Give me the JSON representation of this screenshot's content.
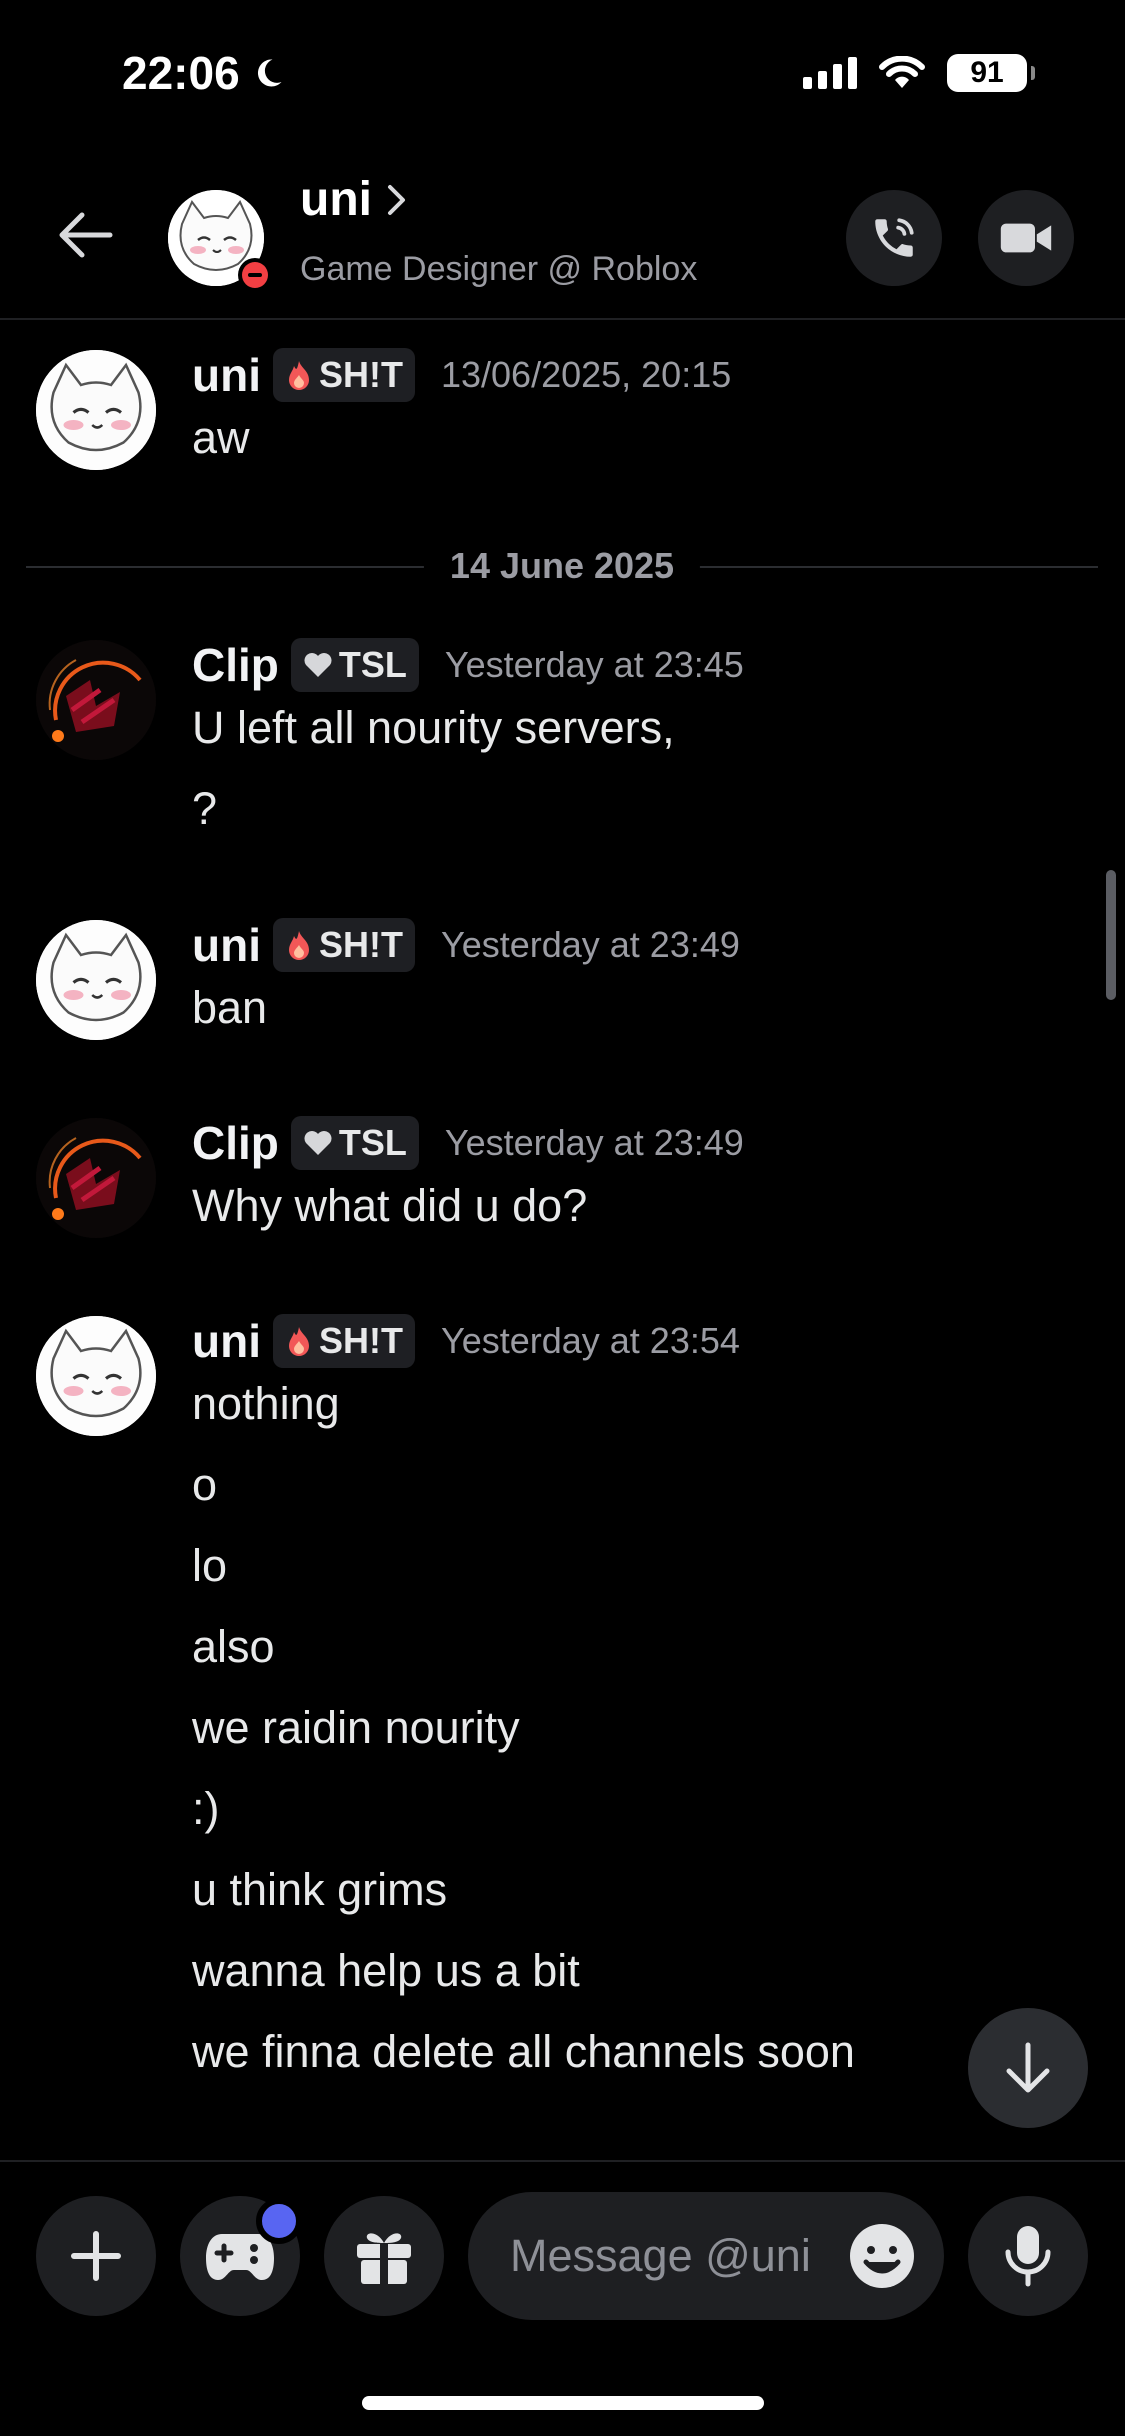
{
  "status_bar": {
    "time": "22:06",
    "battery": "91",
    "icons": [
      "moon-icon",
      "signal-icon",
      "wifi-icon",
      "battery-icon"
    ]
  },
  "header": {
    "name": "uni",
    "subtitle": "Game Designer @ Roblox",
    "status": "do-not-disturb",
    "icons": [
      "back-arrow-icon",
      "chevron-right-icon",
      "phone-icon",
      "video-camera-icon"
    ]
  },
  "date_divider": "14 June 2025",
  "messages": [
    {
      "author": "uni",
      "tag": "SH!T",
      "tag_icon": "fire-icon",
      "timestamp": "13/06/2025, 20:15",
      "lines": [
        "aw"
      ]
    },
    {
      "author": "Clip",
      "tag": "TSL",
      "tag_icon": "heart-icon",
      "timestamp": "Yesterday at 23:45",
      "lines": [
        "U left all nourity servers,",
        "?"
      ]
    },
    {
      "author": "uni",
      "tag": "SH!T",
      "tag_icon": "fire-icon",
      "timestamp": "Yesterday at 23:49",
      "lines": [
        "ban"
      ]
    },
    {
      "author": "Clip",
      "tag": "TSL",
      "tag_icon": "heart-icon",
      "timestamp": "Yesterday at 23:49",
      "lines": [
        "Why what did u do?"
      ]
    },
    {
      "author": "uni",
      "tag": "SH!T",
      "tag_icon": "fire-icon",
      "timestamp": "Yesterday at 23:54",
      "lines": [
        "nothing",
        "o",
        "lo",
        "also",
        "we raidin nourity",
        ":)",
        "u think grims",
        "wanna help us a bit",
        "we finna delete all channels soon"
      ]
    }
  ],
  "composer": {
    "placeholder": "Message @uni",
    "icons": [
      "plus-icon",
      "gamepad-icon",
      "gift-icon",
      "emoji-icon",
      "microphone-icon"
    ]
  },
  "colors": {
    "background": "#000000",
    "accent": "#5865f2",
    "dnd": "#f23f43",
    "muted_text": "#9b9ca3"
  }
}
